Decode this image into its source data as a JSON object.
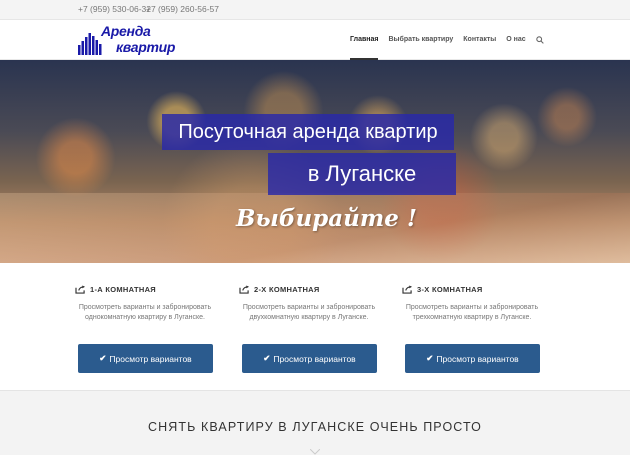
{
  "topbar": {
    "phone1": "+7 (959) 530-06-32",
    "phone2": "+7 (959) 260-56-57"
  },
  "logo": {
    "line1": "Аренда",
    "line2": "квартир",
    "icon": "building-bars-icon",
    "color": "#1a1aa8"
  },
  "nav": {
    "items": [
      {
        "label": "Главная",
        "active": true
      },
      {
        "label": "Выбрать квартиру",
        "active": false
      },
      {
        "label": "Контакты",
        "active": false
      },
      {
        "label": "О нас",
        "active": false
      }
    ],
    "search_icon": "search-icon"
  },
  "hero": {
    "title_line1": "Посуточная аренда квартир",
    "title_line2": "в Луганске",
    "cta": "Выбирайте !",
    "accent": "#2828aa"
  },
  "features": {
    "cards": [
      {
        "title": "1-А КОМНАТНАЯ",
        "description": "Просмотреть варианты и забронировать однокомнатную квартиру в Луганске.",
        "button": "Просмотр вариантов",
        "icon": "share-arrow-icon"
      },
      {
        "title": "2-Х КОМНАТНАЯ",
        "description": "Просмотреть варианты и забронировать двухкомнатную квартиру в Луганске.",
        "button": "Просмотр вариантов",
        "icon": "share-arrow-icon"
      },
      {
        "title": "3-Х КОМНАТНАЯ",
        "description": "Просмотреть варианты и забронировать трехкомнатную квартиру в Луганске.",
        "button": "Просмотр вариантов",
        "icon": "share-arrow-icon"
      }
    ],
    "button_color": "#2b5b8e"
  },
  "bottom": {
    "title": "СНЯТЬ КВАРТИРУ В ЛУГАНСКЕ ОЧЕНЬ ПРОСТО"
  }
}
